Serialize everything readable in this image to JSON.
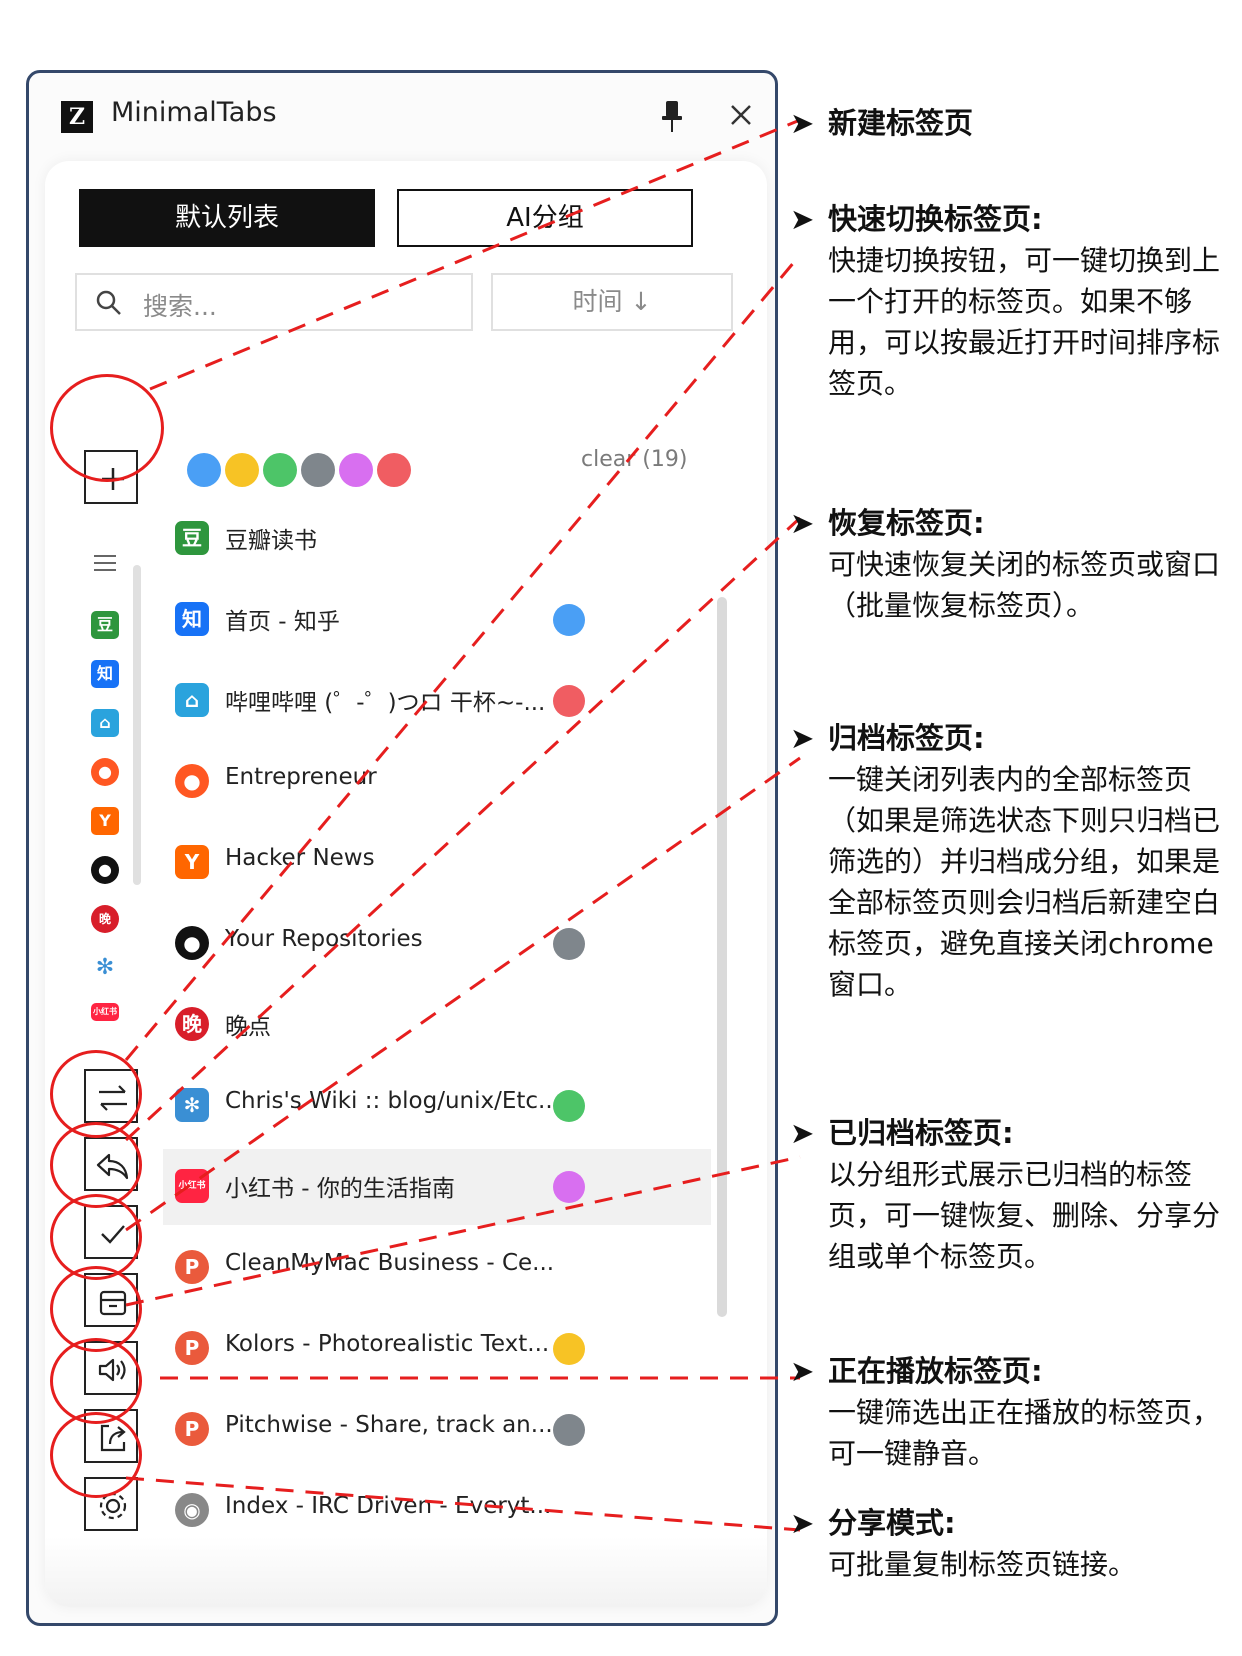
{
  "window": {
    "title": "MinimalTabs",
    "logo_letter": "Z"
  },
  "tabs": {
    "default_list": "默认列表",
    "ai_group": "AI分组"
  },
  "search": {
    "placeholder": "搜索..."
  },
  "sort": {
    "label": "时间 ↓"
  },
  "filters": {
    "colors": [
      "#4a9ff5",
      "#f7c325",
      "#4dc568",
      "#7f868c",
      "#d86ff0",
      "#f05d62"
    ],
    "clear_label": "clear (19)"
  },
  "sidebar": {
    "icons": [
      "list-icon",
      "douban-icon",
      "zhihu-icon",
      "bilibili-icon",
      "reddit-icon",
      "hackernews-icon",
      "github-icon",
      "wandian-icon",
      "wiki-icon",
      "xiaohongshu-icon"
    ]
  },
  "left_toolbar": [
    "new-tab",
    "switch-tab",
    "restore-tab",
    "archive-tabs",
    "archived-tabs",
    "playing-tabs",
    "share-mode",
    "settings"
  ],
  "tabs_list": [
    {
      "title": "豆瓣读书",
      "icon": "douban-icon",
      "icon_text": "豆",
      "icon_color": "#2e963d",
      "dot": null
    },
    {
      "title": "首页 - 知乎",
      "icon": "zhihu-icon",
      "icon_text": "知",
      "icon_color": "#1772f6",
      "dot": "#4a9ff5"
    },
    {
      "title": "哔哩哔哩 (゜-゜)つロ 干杯~-...",
      "icon": "bilibili-icon",
      "icon_text": "⌂",
      "icon_color": "#2aa3dd",
      "dot": "#f05d62"
    },
    {
      "title": "Entrepreneur",
      "icon": "reddit-icon",
      "icon_text": "●",
      "icon_color": "#ff5722",
      "dot": null
    },
    {
      "title": "Hacker News",
      "icon": "hackernews-icon",
      "icon_text": "Y",
      "icon_color": "#ff6600",
      "dot": null
    },
    {
      "title": "Your Repositories",
      "icon": "github-icon",
      "icon_text": "●",
      "icon_color": "#111111",
      "dot": "#7f868c"
    },
    {
      "title": "晚点",
      "icon": "wandian-icon",
      "icon_text": "晚",
      "icon_color": "#d81e2a",
      "dot": null
    },
    {
      "title": "Chris's Wiki :: blog/unix/Etc...",
      "icon": "wiki-icon",
      "icon_text": "✻",
      "icon_color": "#3a8fd4",
      "dot": "#4dc568"
    },
    {
      "title": "小红书 - 你的生活指南",
      "icon": "xiaohongshu-icon",
      "icon_text": "小红书",
      "icon_color": "#ff2442",
      "dot": "#d86ff0"
    },
    {
      "title": "CleanMyMac Business - Ce...",
      "icon": "producthunt-icon",
      "icon_text": "P",
      "icon_color": "#ea5a3c",
      "dot": null
    },
    {
      "title": "Kolors - Photorealistic Text...",
      "icon": "producthunt-icon",
      "icon_text": "P",
      "icon_color": "#ea5a3c",
      "dot": "#f7c325"
    },
    {
      "title": "Pitchwise - Share, track an...",
      "icon": "producthunt-icon",
      "icon_text": "P",
      "icon_color": "#ea5a3c",
      "dot": "#7f868c"
    },
    {
      "title": "Index - IRC Driven - Everyt...",
      "icon": "chrome-icon",
      "icon_text": "◉",
      "icon_color": "#888888",
      "dot": null
    }
  ],
  "annotations": [
    {
      "title": "新建标签页",
      "desc": ""
    },
    {
      "title": "快速切换标签页:",
      "desc": "快捷切换按钮，可一键切换到上一个打开的标签页。如果不够用，可以按最近打开时间排序标签页。"
    },
    {
      "title": "恢复标签页:",
      "desc": "可快速恢复关闭的标签页或窗口（批量恢复标签页）。"
    },
    {
      "title": "归档标签页:",
      "desc": "一键关闭列表内的全部标签页（如果是筛选状态下则只归档已筛选的）并归档成分组，如果是全部标签页则会归档后新建空白标签页，避免直接关闭chrome窗口。"
    },
    {
      "title": "已归档标签页:",
      "desc": "以分组形式展示已归档的标签页，可一键恢复、删除、分享分组或单个标签页。"
    },
    {
      "title": "正在播放标签页:",
      "desc": "一键筛选出正在播放的标签页，可一键静音。"
    },
    {
      "title": "分享模式:",
      "desc": "可批量复制标签页链接。"
    }
  ],
  "accent_colors": {
    "window_border": "#34486a",
    "annotation_red": "#e61e1e"
  }
}
